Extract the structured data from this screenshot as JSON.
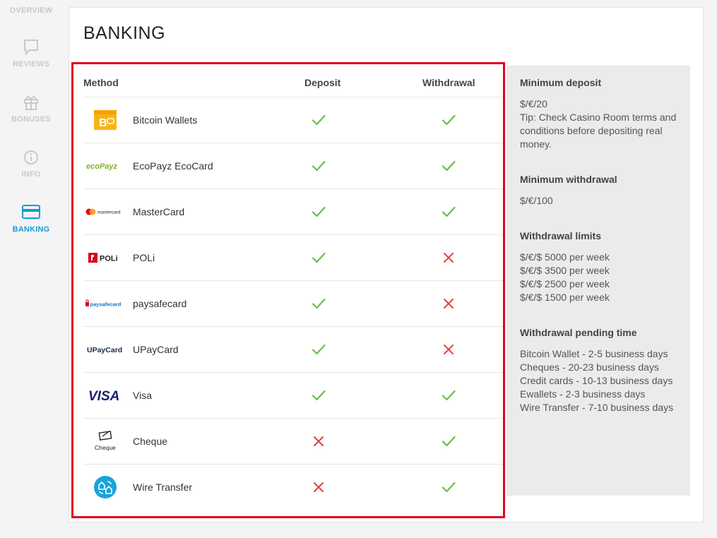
{
  "nav": {
    "overview": "OVERVIEW",
    "reviews": "REVIEWS",
    "bonuses": "BONUSES",
    "info": "INFO",
    "banking": "BANKING",
    "active_color": "#1a9ad6"
  },
  "page": {
    "title": "BANKING"
  },
  "table": {
    "headers": {
      "method": "Method",
      "deposit": "Deposit",
      "withdrawal": "Withdrawal"
    },
    "rows": [
      {
        "name": "Bitcoin Wallets",
        "icon": "bitcoin-wallet-logo",
        "deposit": true,
        "withdrawal": true
      },
      {
        "name": "EcoPayz EcoCard",
        "icon": "ecopayz-logo",
        "logo_text": "ecoPayz",
        "deposit": true,
        "withdrawal": true
      },
      {
        "name": "MasterCard",
        "icon": "mastercard-logo",
        "logo_text": "mastercard",
        "deposit": true,
        "withdrawal": true
      },
      {
        "name": "POLi",
        "icon": "poli-logo",
        "logo_text": "POLi",
        "deposit": true,
        "withdrawal": false
      },
      {
        "name": "paysafecard",
        "icon": "paysafecard-logo",
        "logo_text": "paysafecard",
        "deposit": true,
        "withdrawal": false
      },
      {
        "name": "UPayCard",
        "icon": "upaycard-logo",
        "logo_text": "UPayCard",
        "deposit": true,
        "withdrawal": false
      },
      {
        "name": "Visa",
        "icon": "visa-logo",
        "logo_text": "VISA",
        "deposit": true,
        "withdrawal": true
      },
      {
        "name": "Cheque",
        "icon": "cheque-logo",
        "logo_text": "Cheque",
        "deposit": false,
        "withdrawal": true
      },
      {
        "name": "Wire Transfer",
        "icon": "wire-transfer-logo",
        "deposit": false,
        "withdrawal": true
      }
    ]
  },
  "info": {
    "min_deposit": {
      "title": "Minimum deposit",
      "lines": [
        "$/€/20",
        "Tip: Check Casino Room terms and conditions before depositing real money."
      ]
    },
    "min_withdrawal": {
      "title": "Minimum withdrawal",
      "lines": [
        "$/€/100"
      ]
    },
    "withdrawal_limits": {
      "title": "Withdrawal limits",
      "lines": [
        "$/€/$ 5000 per week",
        "$/€/$ 3500 per week",
        "$/€/$ 2500 per week",
        "$/€/$ 1500 per week"
      ]
    },
    "pending_time": {
      "title": "Withdrawal pending time",
      "lines": [
        "Bitcoin Wallet - 2-5 business days",
        "Cheques - 20-23 business days",
        "Credit cards - 10-13 business days",
        "Ewallets - 2-3 business days",
        "Wire Transfer - 7-10 business days"
      ]
    }
  },
  "colors": {
    "check": "#6cbd45",
    "cross": "#e2413b",
    "highlight": "#e3001b",
    "info_bg": "#ebebeb"
  }
}
